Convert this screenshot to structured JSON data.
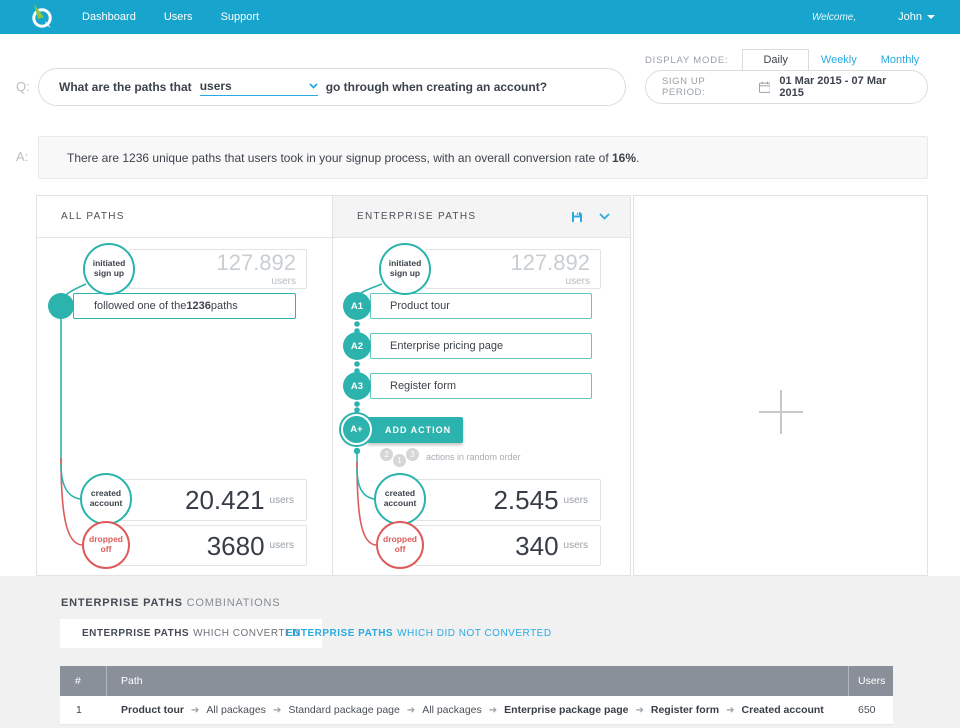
{
  "navbar": {
    "items": [
      {
        "label": "Dashboard"
      },
      {
        "label": "Users"
      },
      {
        "label": "Support"
      }
    ],
    "welcome": "Welcome,",
    "user": "John"
  },
  "display_mode": {
    "label": "DISPLAY MODE:",
    "tabs": [
      {
        "label": "Daily",
        "active": true
      },
      {
        "label": "Weekly",
        "active": false
      },
      {
        "label": "Monthly",
        "active": false
      }
    ]
  },
  "signup_period": {
    "label": "SIGN UP PERIOD:",
    "value": "01 Mar 2015 - 07 Mar 2015"
  },
  "question": {
    "prefix": "Q:",
    "before": "What are the paths that",
    "dropdown_value": "users",
    "after": "go through when creating an account?"
  },
  "answer": {
    "prefix": "A:",
    "before": "There are 1236 unique paths that users took in your signup process, with an overall conversion rate of ",
    "highlight": "16%",
    "after": "."
  },
  "panels": {
    "all_paths": {
      "title": "ALL PATHS",
      "initiated": {
        "label": "initiated sign up",
        "value": "127.892",
        "unit": "users"
      },
      "followed": {
        "before": "followed one of the ",
        "bold": "1236",
        "after": " paths"
      },
      "created": {
        "label": "created account",
        "value": "20.421",
        "unit": "users"
      },
      "dropped": {
        "label": "dropped off",
        "value": "3680",
        "unit": "users"
      }
    },
    "enterprise_paths": {
      "title": "ENTERPRISE PATHS",
      "initiated": {
        "label": "initiated sign up",
        "value": "127.892",
        "unit": "users"
      },
      "actions": [
        {
          "badge": "A1",
          "label": "Product tour"
        },
        {
          "badge": "A2",
          "label": "Enterprise pricing page"
        },
        {
          "badge": "A3",
          "label": "Register form"
        }
      ],
      "add_action": {
        "badge": "A+",
        "label": "ADD ACTION"
      },
      "random_order": {
        "badges": [
          "2",
          "1",
          "3"
        ],
        "label": "actions in random order"
      },
      "created": {
        "label": "created account",
        "value": "2.545",
        "unit": "users"
      },
      "dropped": {
        "label": "dropped off",
        "value": "340",
        "unit": "users"
      }
    }
  },
  "combinations": {
    "title_bold": "ENTERPRISE PATHS",
    "title_rest": "COMBINATIONS",
    "tabs": [
      {
        "bold": "ENTERPRISE PATHS",
        "rest": "WHICH CONVERTED",
        "active": true
      },
      {
        "bold": "ENTERPRISE PATHS",
        "rest": "WHICH DID NOT CONVERTED",
        "active": false
      }
    ],
    "table": {
      "headers": [
        "#",
        "Path",
        "Users"
      ],
      "rows": [
        {
          "num": "1",
          "users": "650",
          "path": [
            {
              "label": "Product tour",
              "bold": true
            },
            {
              "label": "All packages",
              "bold": false
            },
            {
              "label": "Standard package page",
              "bold": false
            },
            {
              "label": "All packages",
              "bold": false
            },
            {
              "label": "Enterprise package page",
              "bold": true
            },
            {
              "label": "Register form",
              "bold": true
            },
            {
              "label": "Created account",
              "bold": true
            }
          ]
        }
      ]
    }
  },
  "colors": {
    "navbar": "#17a4cd",
    "teal": "#2db3ad",
    "red": "#dd5b5b",
    "link": "#29abe2",
    "table_header": "#8a909a"
  }
}
